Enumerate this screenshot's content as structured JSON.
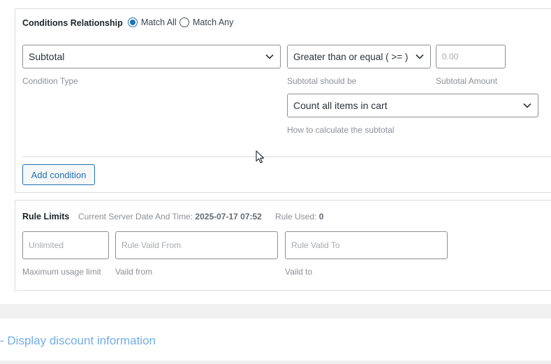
{
  "conditions": {
    "relationship_label": "Conditions Relationship",
    "match_all_label": "Match All",
    "match_any_label": "Match Any",
    "condition_type_value": "Subtotal",
    "condition_type_label": "Condition Type",
    "operator_value": "Greater than or equal ( >= )",
    "operator_label": "Subtotal should be",
    "amount_placeholder": "0.00",
    "amount_label": "Subtotal Amount",
    "calc_value": "Count all items in cart",
    "calc_label": "How to calculate the subtotal",
    "add_condition_label": "Add condition"
  },
  "rule_limits": {
    "title": "Rule Limits",
    "server_time_label": "Current Server Date And Time:",
    "server_time_value": "2025-07-17 07:52",
    "rule_used_label": "Rule Used:",
    "rule_used_value": "0",
    "max_usage_placeholder": "Unlimited",
    "max_usage_label": "Maximum usage limit",
    "valid_from_placeholder": "Rule Vaild From",
    "valid_from_label": "Vaild from",
    "valid_to_placeholder": "Rule Valid To",
    "valid_to_label": "Vaild to"
  },
  "display_section": {
    "title": "- Display discount information"
  },
  "icons": {
    "select_arrow": "chevron-down-icon",
    "cursor": "mouse-pointer-icon"
  },
  "colors": {
    "accent": "#2271b1",
    "link": "#72aee6",
    "border": "#dcdcde",
    "muted_text": "#8c8f94"
  }
}
